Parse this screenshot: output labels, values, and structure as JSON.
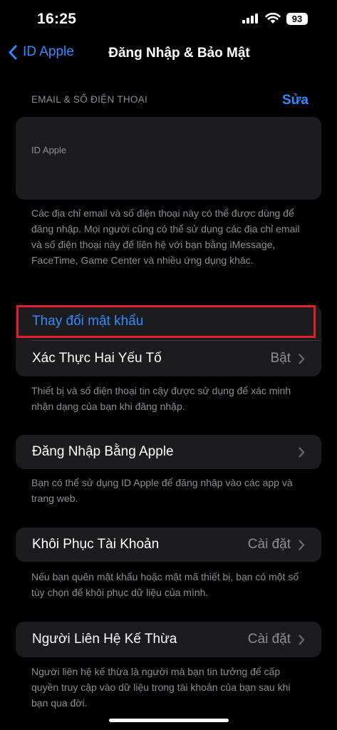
{
  "status_bar": {
    "time": "16:25",
    "battery": "93"
  },
  "nav": {
    "back_label": "ID Apple",
    "title": "Đăng Nhập & Bảo Mật"
  },
  "email_section": {
    "header": "EMAIL & SỐ ĐIỆN THOẠI",
    "edit_label": "Sửa",
    "id_label": "ID Apple",
    "footer": "Các địa chỉ email và số điện thoại này có thể được dùng để đăng nhập. Mọi người cũng có thể sử dụng các địa chỉ email và số điện thoại này để liên hệ với bạn bằng iMessage, FaceTime, Game Center và nhiều ứng dụng khác."
  },
  "password_section": {
    "change_password": "Thay đổi mật khẩu",
    "two_factor_label": "Xác Thực Hai Yếu Tố",
    "two_factor_value": "Bật",
    "footer": "Thiết bị và số điện thoại tin cậy được sử dụng để xác minh nhận dạng của bạn khi đăng nhập."
  },
  "sign_in_apple": {
    "label": "Đăng Nhập Bằng Apple",
    "footer": "Bạn có thể sử dụng ID Apple để đăng nhập vào các app và trang web."
  },
  "account_recovery": {
    "label": "Khôi Phục Tài Khoản",
    "value": "Cài đặt",
    "footer": "Nếu bạn quên mật khẩu hoặc mật mã thiết bị, bạn có một số tùy chọn để khôi phục dữ liệu của mình."
  },
  "legacy_contact": {
    "label": "Người Liên Hệ Kế Thừa",
    "value": "Cài đặt",
    "footer": "Người liên hệ kế thừa là người mà bạn tin tưởng để cấp quyền truy cập vào dữ liệu trong tài khoản của bạn sau khi bạn qua đời."
  },
  "colors": {
    "accent": "#2f8cff",
    "highlight": "#e0212b",
    "card": "#1c1c1e"
  },
  "icons": [
    "signal-icon",
    "wifi-icon",
    "battery-icon",
    "chevron-left-icon",
    "chevron-right-icon"
  ]
}
